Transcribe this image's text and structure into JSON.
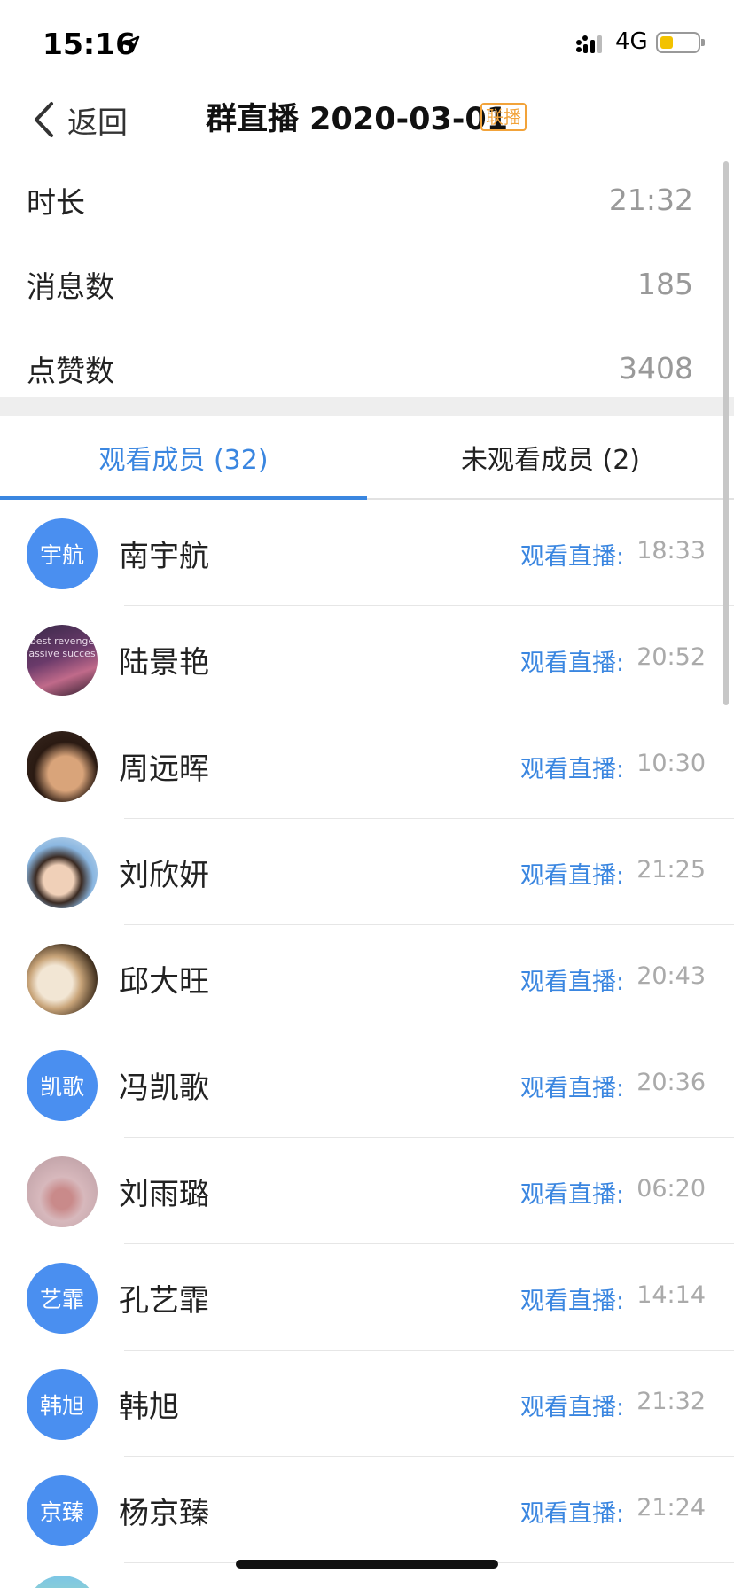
{
  "status_bar": {
    "time": "15:16",
    "network": "4G"
  },
  "nav": {
    "back_label": "返回",
    "title": "群直播 2020-03-01",
    "tag": "联播"
  },
  "stats": [
    {
      "label": "时长",
      "value": "21:32"
    },
    {
      "label": "消息数",
      "value": "185"
    },
    {
      "label": "点赞数",
      "value": "3408"
    }
  ],
  "tabs": [
    {
      "label": "观看成员 (32)",
      "active": true
    },
    {
      "label": "未观看成员 (2)",
      "active": false
    }
  ],
  "watch_label": "观看直播:",
  "members": [
    {
      "name": "南宇航",
      "avatar_text": "宇航",
      "time": "18:33"
    },
    {
      "name": "陆景艳",
      "avatar_text": "",
      "avatar_image_text": [
        "best revenge",
        "assive succes"
      ],
      "time": "20:52"
    },
    {
      "name": "周远晖",
      "avatar_text": "",
      "time": "10:30"
    },
    {
      "name": "刘欣妍",
      "avatar_text": "",
      "time": "21:25"
    },
    {
      "name": "邱大旺",
      "avatar_text": "",
      "time": "20:43"
    },
    {
      "name": "冯凯歌",
      "avatar_text": "凯歌",
      "time": "20:36"
    },
    {
      "name": "刘雨璐",
      "avatar_text": "",
      "time": "06:20"
    },
    {
      "name": "孔艺霏",
      "avatar_text": "艺霏",
      "time": "14:14"
    },
    {
      "name": "韩旭",
      "avatar_text": "韩旭",
      "time": "21:32"
    },
    {
      "name": "杨京臻",
      "avatar_text": "京臻",
      "time": "21:24"
    }
  ],
  "colors": {
    "accent": "#3a86e0",
    "avatar_bg": "#4a8ff0",
    "tag": "#f2a33a"
  }
}
